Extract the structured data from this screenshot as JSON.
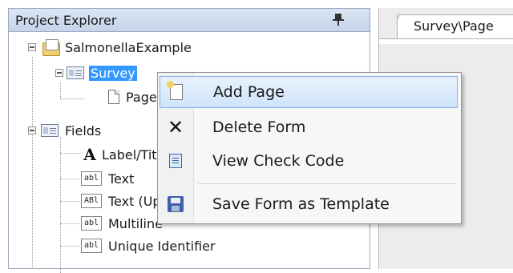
{
  "explorer": {
    "title": "Project Explorer",
    "pin_icon": "pin-icon"
  },
  "tree": {
    "project": "SalmonellaExample",
    "form": "Survey",
    "page": "Page",
    "fields": "Fields",
    "field_items": [
      {
        "icon": "label-icon",
        "label": "Label/Title"
      },
      {
        "icon": "textbox-icon",
        "label": "Text"
      },
      {
        "icon": "uppercase-textbox-icon",
        "label": "Text (Uppercase)"
      },
      {
        "icon": "multiline-textbox-icon",
        "label": "Multiline"
      },
      {
        "icon": "unique-id-icon",
        "label": "Unique Identifier"
      }
    ],
    "abl_glyph": "abl",
    "abl_upper_glyph": "ABl",
    "label_glyph": "A"
  },
  "document": {
    "tab_label": "Survey\\Page"
  },
  "context_menu": {
    "items": [
      {
        "icon": "add-page-icon",
        "label": "Add Page"
      },
      {
        "icon": "delete-icon",
        "label": "Delete Form",
        "glyph": "✕"
      },
      {
        "icon": "check-code-icon",
        "label": "View Check Code"
      },
      {
        "icon": "save-icon",
        "label": "Save Form as Template"
      }
    ]
  },
  "colors": {
    "selection": "#3399ff",
    "menu_hover": "#cfe4fb",
    "header": "#c5d4ea"
  }
}
